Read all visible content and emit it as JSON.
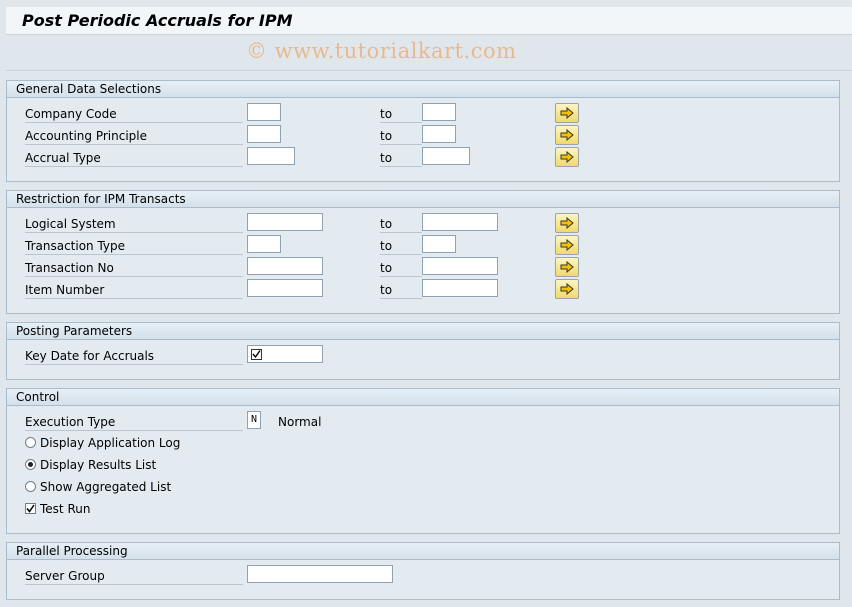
{
  "title": "Post Periodic Accruals for IPM",
  "watermark": "© www.tutorialkart.com",
  "to_label": "to",
  "groups": {
    "general": {
      "header": "General Data Selections",
      "rows": [
        {
          "label": "Company Code"
        },
        {
          "label": "Accounting Principle"
        },
        {
          "label": "Accrual Type"
        }
      ]
    },
    "restriction": {
      "header": "Restriction for IPM Transacts",
      "rows": [
        {
          "label": "Logical System"
        },
        {
          "label": "Transaction Type"
        },
        {
          "label": "Transaction No"
        },
        {
          "label": "Item Number"
        }
      ]
    },
    "posting": {
      "header": "Posting Parameters",
      "key_date_label": "Key Date for Accruals"
    },
    "control": {
      "header": "Control",
      "execution_type_label": "Execution Type",
      "execution_type_value": "N",
      "execution_type_text": "Normal",
      "options": [
        {
          "label": "Display Application Log",
          "selected": false
        },
        {
          "label": "Display Results List",
          "selected": true
        },
        {
          "label": "Show Aggregated List",
          "selected": false
        }
      ],
      "test_run_label": "Test Run",
      "test_run_checked": true
    },
    "parallel": {
      "header": "Parallel Processing",
      "server_group_label": "Server Group"
    }
  },
  "icons": {
    "multiple_selection": "arrow-right-icon",
    "required_check": "check-icon"
  },
  "colors": {
    "background": "#dfe6ec",
    "group_border": "#a9bccd",
    "button_yellow": "#f1d96a",
    "watermark": "#e9b98e"
  }
}
